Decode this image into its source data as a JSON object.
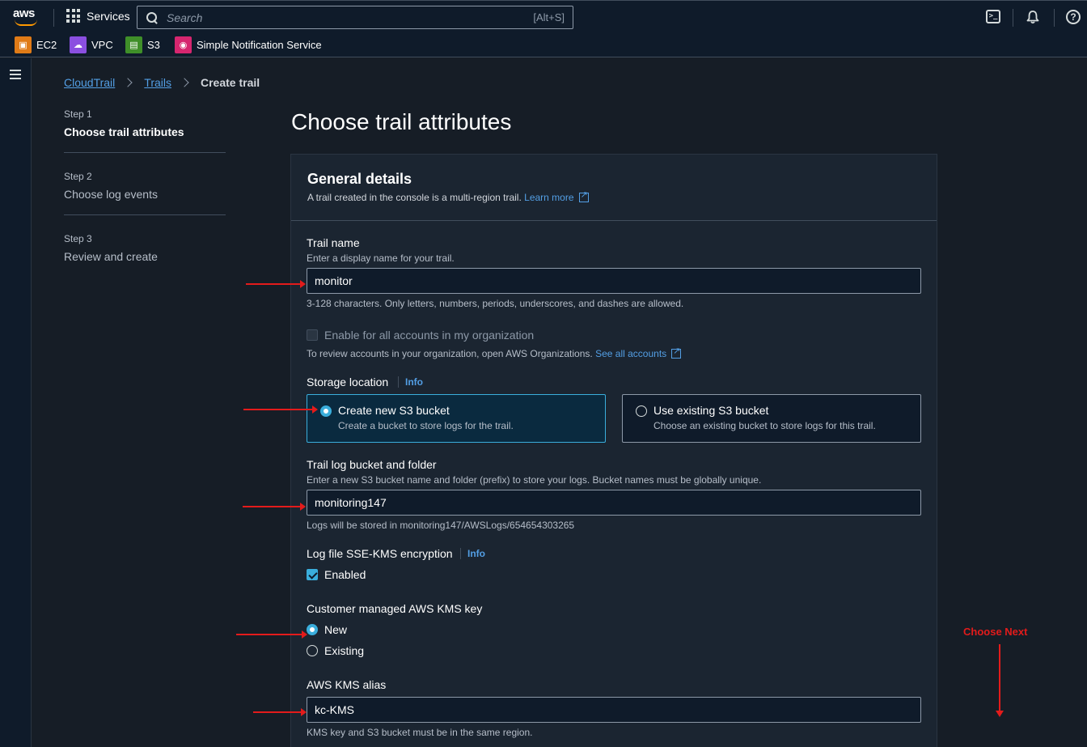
{
  "topnav": {
    "logo": "aws",
    "services": "Services",
    "search_placeholder": "Search",
    "search_shortcut": "[Alt+S]",
    "icons": [
      "cloudshell-icon",
      "bell-icon",
      "help-icon"
    ]
  },
  "favorites": [
    {
      "label": "EC2",
      "icon": "ec2-icon",
      "color": "#e07b17"
    },
    {
      "label": "VPC",
      "icon": "vpc-icon",
      "color": "#8b4fe0"
    },
    {
      "label": "S3",
      "icon": "s3-icon",
      "color": "#3f8f29"
    },
    {
      "label": "Simple Notification Service",
      "icon": "sns-icon",
      "color": "#d6266f"
    }
  ],
  "breadcrumb": {
    "item1": "CloudTrail",
    "item2": "Trails",
    "current": "Create trail"
  },
  "steps": [
    {
      "num": "Step 1",
      "title": "Choose trail attributes"
    },
    {
      "num": "Step 2",
      "title": "Choose log events"
    },
    {
      "num": "Step 3",
      "title": "Review and create"
    }
  ],
  "page_title": "Choose trail attributes",
  "general": {
    "heading": "General details",
    "desc": "A trail created in the console is a multi-region trail.",
    "learn_more": "Learn more"
  },
  "trail_name": {
    "label": "Trail name",
    "desc": "Enter a display name for your trail.",
    "value": "monitor",
    "hint": "3-128 characters. Only letters, numbers, periods, underscores, and dashes are allowed."
  },
  "org": {
    "label": "Enable for all accounts in my organization",
    "desc": "To review accounts in your organization, open AWS Organizations.",
    "link": "See all accounts"
  },
  "storage": {
    "label": "Storage location",
    "info": "Info",
    "new_title": "Create new S3 bucket",
    "new_desc": "Create a bucket to store logs for the trail.",
    "existing_title": "Use existing S3 bucket",
    "existing_desc": "Choose an existing bucket to store logs for this trail."
  },
  "bucket": {
    "label": "Trail log bucket and folder",
    "desc": "Enter a new S3 bucket name and folder (prefix) to store your logs. Bucket names must be globally unique.",
    "value": "monitoring147",
    "hint": "Logs will be stored in monitoring147/AWSLogs/654654303265"
  },
  "encryption": {
    "label": "Log file SSE-KMS encryption",
    "info": "Info",
    "enabled_label": "Enabled"
  },
  "kms_key": {
    "label": "Customer managed AWS KMS key",
    "opt_new": "New",
    "opt_existing": "Existing"
  },
  "kms_alias": {
    "label": "AWS KMS alias",
    "value": "kc-KMS",
    "hint": "KMS key and S3 bucket must be in the same region."
  },
  "annotation": {
    "text": "Choose Next",
    "color": "#e31b1b"
  }
}
